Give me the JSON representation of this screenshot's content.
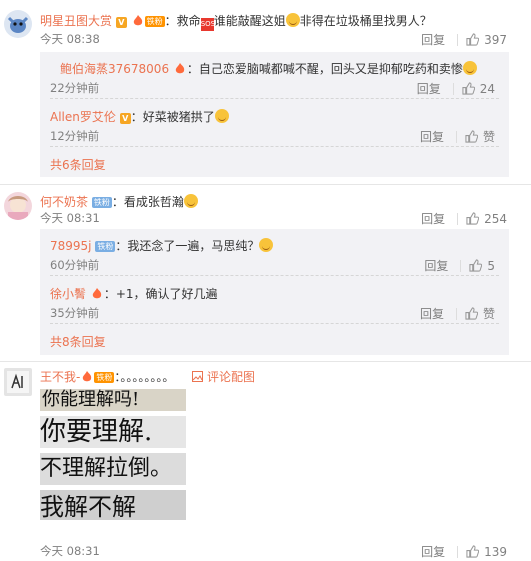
{
  "c1": {
    "name": "明星丑图大赏",
    "fans_badge": "铁粉",
    "text_pre": "：救命",
    "text_mid": "谁能敲醒这姐",
    "text_post": "非得在垃圾桶里找男人？",
    "time": "今天 08:38",
    "reply": "回复",
    "likes": "397",
    "replies": [
      {
        "name": "鲍伯海蒸37678006",
        "text": "：自己恋爱脑喊都喊不醒，回头又是抑郁吃药和卖惨",
        "time": "22分钟前",
        "reply": "回复",
        "likes": "24"
      },
      {
        "name": "Allen罗艾伦",
        "text": "：好菜被猪拱了",
        "time": "12分钟前",
        "reply": "回复",
        "likes": "赞"
      }
    ],
    "more": "共6条回复"
  },
  "c2": {
    "name": "何不奶茶",
    "badge": "铁粉",
    "text": "：看成张哲瀚",
    "time": "今天 08:31",
    "reply": "回复",
    "likes": "254",
    "replies": [
      {
        "name": "78995j",
        "badge": "铁粉",
        "text": "：我还念了一遍，马思纯？",
        "time": "60分钟前",
        "reply": "回复",
        "likes": "5"
      },
      {
        "name": "徐小鬌",
        "text": "：+1，确认了好几遍",
        "time": "35分钟前",
        "reply": "回复",
        "likes": "赞"
      }
    ],
    "more": "共8条回复"
  },
  "c3": {
    "name": "王不我-",
    "badge": "铁粉",
    "text": "：。。。。。。。。",
    "image_link": "评论配图",
    "handwriting": [
      "你能理解吗!",
      "你要理解.",
      "不理解拉倒。",
      "我解不解"
    ],
    "time": "今天 08:31",
    "reply": "回复",
    "likes": "139"
  }
}
